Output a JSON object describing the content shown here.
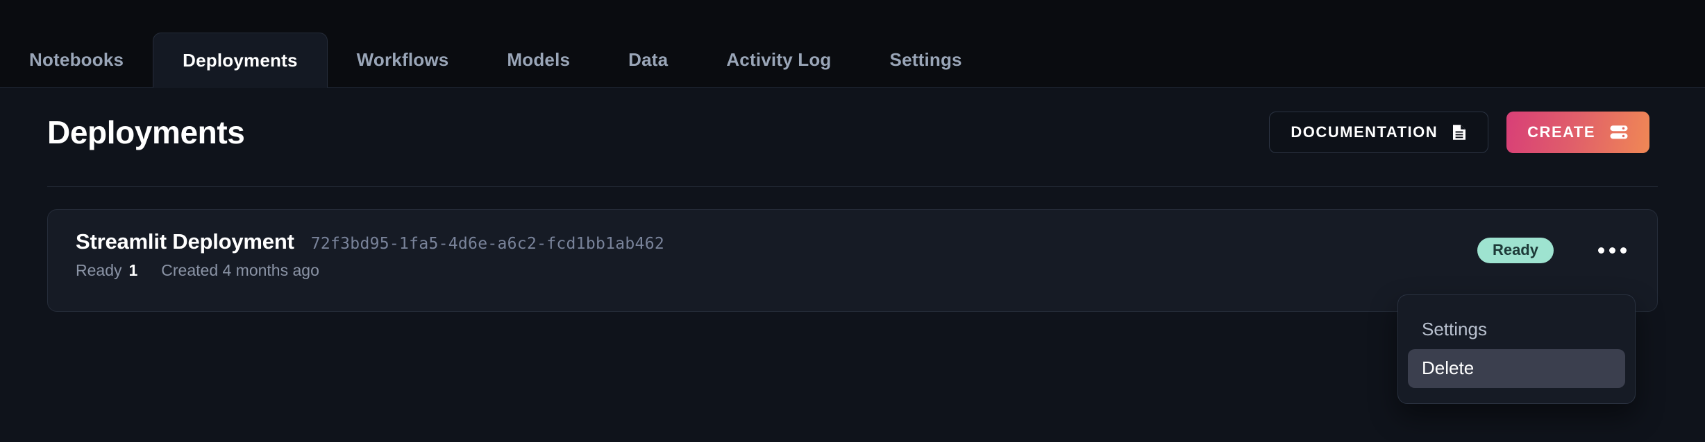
{
  "tabs": [
    {
      "label": "Notebooks",
      "active": false
    },
    {
      "label": "Deployments",
      "active": true
    },
    {
      "label": "Workflows",
      "active": false
    },
    {
      "label": "Models",
      "active": false
    },
    {
      "label": "Data",
      "active": false
    },
    {
      "label": "Activity Log",
      "active": false
    },
    {
      "label": "Settings",
      "active": false
    }
  ],
  "header": {
    "title": "Deployments",
    "documentation_label": "DOCUMENTATION",
    "documentation_icon": "document-icon",
    "create_label": "CREATE",
    "create_icon": "server-icon"
  },
  "deployment": {
    "name": "Streamlit Deployment",
    "uuid": "72f3bd95-1fa5-4d6e-a6c2-fcd1bb1ab462",
    "ready_label": "Ready",
    "ready_count": "1",
    "created": "Created 4 months ago",
    "status": "Ready",
    "menu_icon": "kebab-menu-icon"
  },
  "dropdown": {
    "items": [
      {
        "label": "Settings",
        "highlighted": false
      },
      {
        "label": "Delete",
        "highlighted": true
      }
    ]
  },
  "colors": {
    "page_background": "#0f131b",
    "tabbar_background": "#0a0c10",
    "card_background": "#161b25",
    "status_badge": "#9ee3d0",
    "create_gradient_start": "#d83f77",
    "create_gradient_end": "#f08855",
    "menu_highlight": "#3b3f4e"
  }
}
